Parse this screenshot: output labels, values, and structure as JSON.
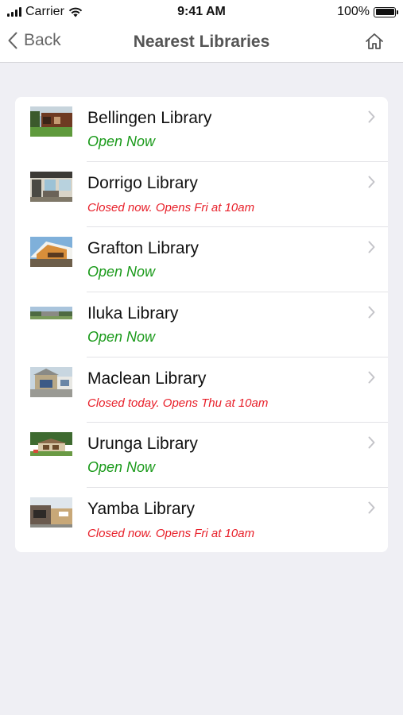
{
  "status_bar": {
    "carrier": "Carrier",
    "time": "9:41 AM",
    "battery": "100%"
  },
  "nav": {
    "back_label": "Back",
    "title": "Nearest Libraries",
    "home_icon": "home-icon"
  },
  "colors": {
    "open": "#1a9a1a",
    "closed": "#e8202a",
    "background": "#efeff4"
  },
  "libraries": [
    {
      "name": "Bellingen Library",
      "status": "Open Now",
      "state": "open"
    },
    {
      "name": "Dorrigo Library",
      "status": "Closed now. Opens Fri at 10am",
      "state": "closed"
    },
    {
      "name": "Grafton Library",
      "status": "Open Now",
      "state": "open"
    },
    {
      "name": "Iluka Library",
      "status": "Open Now",
      "state": "open"
    },
    {
      "name": "Maclean Library",
      "status": "Closed today. Opens Thu at 10am",
      "state": "closed"
    },
    {
      "name": "Urunga Library",
      "status": "Open Now",
      "state": "open"
    },
    {
      "name": "Yamba Library",
      "status": "Closed now. Opens Fri at 10am",
      "state": "closed"
    }
  ]
}
